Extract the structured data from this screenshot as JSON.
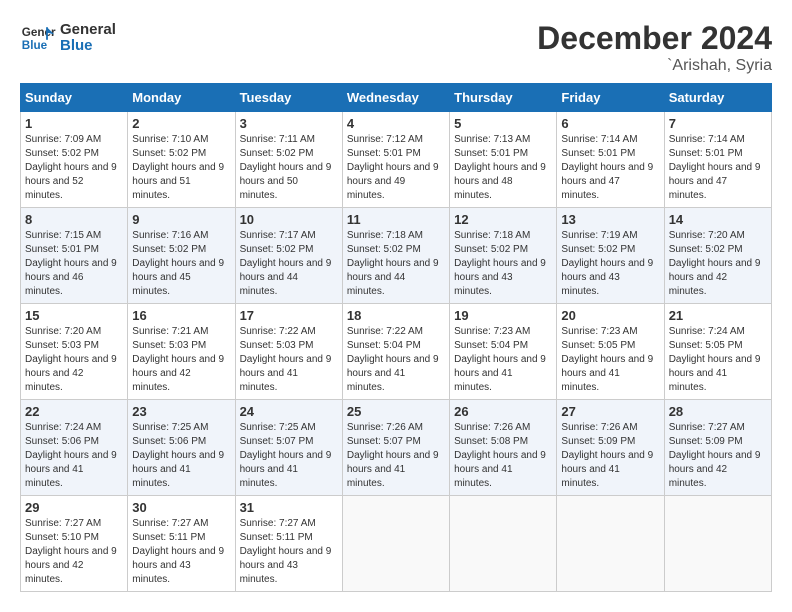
{
  "logo": {
    "line1": "General",
    "line2": "Blue"
  },
  "title": "December 2024",
  "location": "`Arishah, Syria",
  "weekdays": [
    "Sunday",
    "Monday",
    "Tuesday",
    "Wednesday",
    "Thursday",
    "Friday",
    "Saturday"
  ],
  "days": [
    null,
    null,
    {
      "date": "1",
      "sunrise": "7:09 AM",
      "sunset": "5:02 PM",
      "daylight": "9 hours and 52 minutes."
    },
    {
      "date": "2",
      "sunrise": "7:10 AM",
      "sunset": "5:02 PM",
      "daylight": "9 hours and 51 minutes."
    },
    {
      "date": "3",
      "sunrise": "7:11 AM",
      "sunset": "5:02 PM",
      "daylight": "9 hours and 50 minutes."
    },
    {
      "date": "4",
      "sunrise": "7:12 AM",
      "sunset": "5:01 PM",
      "daylight": "9 hours and 49 minutes."
    },
    {
      "date": "5",
      "sunrise": "7:13 AM",
      "sunset": "5:01 PM",
      "daylight": "9 hours and 48 minutes."
    },
    {
      "date": "6",
      "sunrise": "7:14 AM",
      "sunset": "5:01 PM",
      "daylight": "9 hours and 47 minutes."
    },
    {
      "date": "7",
      "sunrise": "7:14 AM",
      "sunset": "5:01 PM",
      "daylight": "9 hours and 47 minutes."
    },
    {
      "date": "8",
      "sunrise": "7:15 AM",
      "sunset": "5:01 PM",
      "daylight": "9 hours and 46 minutes."
    },
    {
      "date": "9",
      "sunrise": "7:16 AM",
      "sunset": "5:02 PM",
      "daylight": "9 hours and 45 minutes."
    },
    {
      "date": "10",
      "sunrise": "7:17 AM",
      "sunset": "5:02 PM",
      "daylight": "9 hours and 44 minutes."
    },
    {
      "date": "11",
      "sunrise": "7:18 AM",
      "sunset": "5:02 PM",
      "daylight": "9 hours and 44 minutes."
    },
    {
      "date": "12",
      "sunrise": "7:18 AM",
      "sunset": "5:02 PM",
      "daylight": "9 hours and 43 minutes."
    },
    {
      "date": "13",
      "sunrise": "7:19 AM",
      "sunset": "5:02 PM",
      "daylight": "9 hours and 43 minutes."
    },
    {
      "date": "14",
      "sunrise": "7:20 AM",
      "sunset": "5:02 PM",
      "daylight": "9 hours and 42 minutes."
    },
    {
      "date": "15",
      "sunrise": "7:20 AM",
      "sunset": "5:03 PM",
      "daylight": "9 hours and 42 minutes."
    },
    {
      "date": "16",
      "sunrise": "7:21 AM",
      "sunset": "5:03 PM",
      "daylight": "9 hours and 42 minutes."
    },
    {
      "date": "17",
      "sunrise": "7:22 AM",
      "sunset": "5:03 PM",
      "daylight": "9 hours and 41 minutes."
    },
    {
      "date": "18",
      "sunrise": "7:22 AM",
      "sunset": "5:04 PM",
      "daylight": "9 hours and 41 minutes."
    },
    {
      "date": "19",
      "sunrise": "7:23 AM",
      "sunset": "5:04 PM",
      "daylight": "9 hours and 41 minutes."
    },
    {
      "date": "20",
      "sunrise": "7:23 AM",
      "sunset": "5:05 PM",
      "daylight": "9 hours and 41 minutes."
    },
    {
      "date": "21",
      "sunrise": "7:24 AM",
      "sunset": "5:05 PM",
      "daylight": "9 hours and 41 minutes."
    },
    {
      "date": "22",
      "sunrise": "7:24 AM",
      "sunset": "5:06 PM",
      "daylight": "9 hours and 41 minutes."
    },
    {
      "date": "23",
      "sunrise": "7:25 AM",
      "sunset": "5:06 PM",
      "daylight": "9 hours and 41 minutes."
    },
    {
      "date": "24",
      "sunrise": "7:25 AM",
      "sunset": "5:07 PM",
      "daylight": "9 hours and 41 minutes."
    },
    {
      "date": "25",
      "sunrise": "7:26 AM",
      "sunset": "5:07 PM",
      "daylight": "9 hours and 41 minutes."
    },
    {
      "date": "26",
      "sunrise": "7:26 AM",
      "sunset": "5:08 PM",
      "daylight": "9 hours and 41 minutes."
    },
    {
      "date": "27",
      "sunrise": "7:26 AM",
      "sunset": "5:09 PM",
      "daylight": "9 hours and 41 minutes."
    },
    {
      "date": "28",
      "sunrise": "7:27 AM",
      "sunset": "5:09 PM",
      "daylight": "9 hours and 42 minutes."
    },
    {
      "date": "29",
      "sunrise": "7:27 AM",
      "sunset": "5:10 PM",
      "daylight": "9 hours and 42 minutes."
    },
    {
      "date": "30",
      "sunrise": "7:27 AM",
      "sunset": "5:11 PM",
      "daylight": "9 hours and 43 minutes."
    },
    {
      "date": "31",
      "sunrise": "7:27 AM",
      "sunset": "5:11 PM",
      "daylight": "9 hours and 43 minutes."
    }
  ]
}
